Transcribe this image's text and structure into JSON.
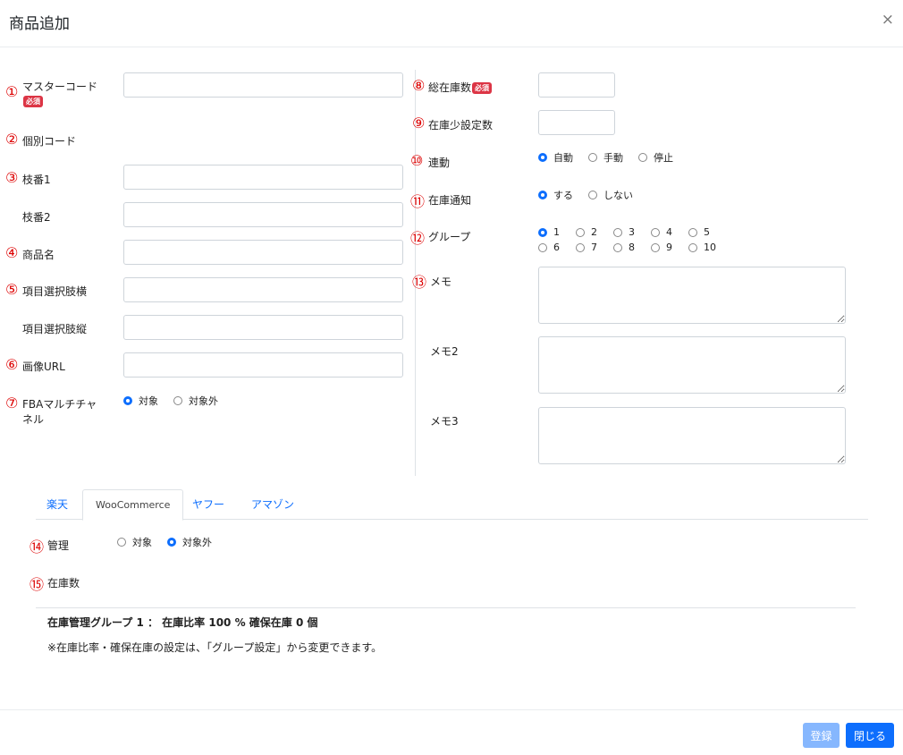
{
  "header": {
    "title": "商品追加",
    "close_symbol": "×"
  },
  "required_badge": "必須",
  "left": {
    "master_code": {
      "num": "①",
      "label": "マスターコード"
    },
    "individual_code": {
      "num": "②",
      "label": "個別コード"
    },
    "branch1": {
      "num": "③",
      "label": "枝番1"
    },
    "branch2": {
      "label": "枝番2"
    },
    "product_name": {
      "num": "④",
      "label": "商品名"
    },
    "option_h": {
      "num": "⑤",
      "label": "項目選択肢横"
    },
    "option_v": {
      "label": "項目選択肢縦"
    },
    "image_url": {
      "num": "⑥",
      "label": "画像URL"
    },
    "fba": {
      "num": "⑦",
      "label": "FBAマルチチャネル",
      "options": [
        "対象",
        "対象外"
      ],
      "selected": 0
    }
  },
  "right": {
    "total_stock": {
      "num": "⑧",
      "label": "総在庫数"
    },
    "low_stock": {
      "num": "⑨",
      "label": "在庫少設定数"
    },
    "link": {
      "num": "⑩",
      "label": "連動",
      "options": [
        "自動",
        "手動",
        "停止"
      ],
      "selected": 0
    },
    "notify": {
      "num": "⑪",
      "label": "在庫通知",
      "options": [
        "する",
        "しない"
      ],
      "selected": 0
    },
    "group": {
      "num": "⑫",
      "label": "グループ",
      "options_row1": [
        "1",
        "2",
        "3",
        "4",
        "5"
      ],
      "options_row2": [
        "6",
        "7",
        "8",
        "9",
        "10"
      ],
      "selected": "1"
    },
    "memo": {
      "num": "⑬",
      "label": "メモ"
    },
    "memo2": {
      "label": "メモ2"
    },
    "memo3": {
      "label": "メモ3"
    }
  },
  "tabs": [
    {
      "label": "楽天",
      "active": false
    },
    {
      "label": "WooCommerce",
      "active": true
    },
    {
      "label": "ヤフー",
      "active": false
    },
    {
      "label": "アマゾン",
      "active": false
    }
  ],
  "tab_content": {
    "manage": {
      "num": "⑭",
      "label": "管理",
      "options": [
        "対象",
        "対象外"
      ],
      "selected": 1
    },
    "stock": {
      "num": "⑮",
      "label": "在庫数"
    },
    "summary": "在庫管理グループ 1 ： 在庫比率 100 % 確保在庫 0 個",
    "note": "※在庫比率・確保在庫の設定は、「グループ設定」から変更できます。"
  },
  "footer": {
    "register_label": "登録",
    "close_label": "閉じる"
  },
  "colors": {
    "primary": "#0d6efd",
    "primary_disabled": "#86b7fe",
    "required": "#dc3545",
    "circled_number": "#dd0000"
  }
}
